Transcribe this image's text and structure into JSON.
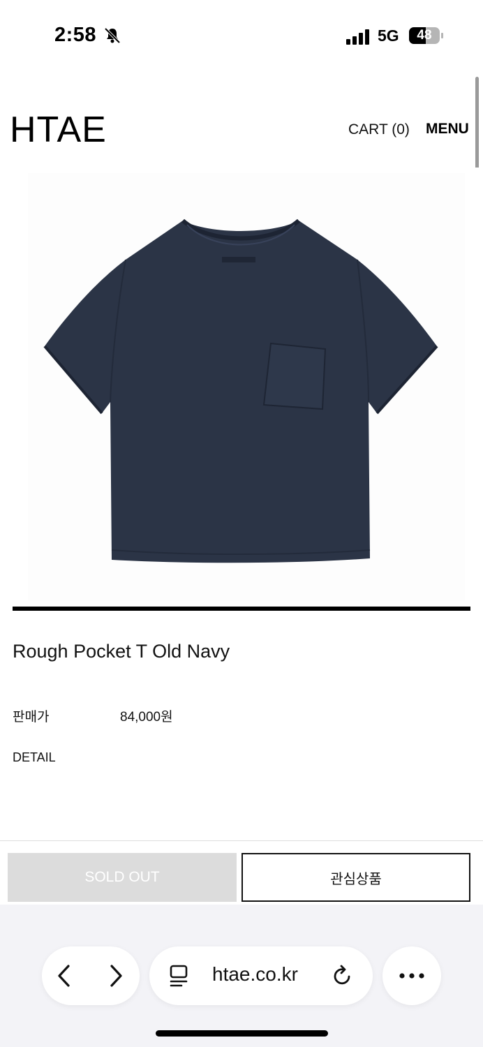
{
  "status_bar": {
    "time": "2:58",
    "network": "5G",
    "battery": "48",
    "icons": [
      "bell-slash-icon",
      "signal-icon",
      "battery-icon"
    ]
  },
  "header": {
    "logo": "HTAE",
    "cart": "CART (0)",
    "menu": "MENU"
  },
  "product": {
    "image_icon": "tshirt-image",
    "name": "Rough Pocket T Old Navy",
    "price_label": "판매가",
    "price_value": "84,000원",
    "detail_label": "DETAIL",
    "shirt_color": "#2b3446"
  },
  "actions": {
    "sold_out": "SOLD OUT",
    "wishlist": "관심상품"
  },
  "browser": {
    "url": "htae.co.kr",
    "icons": [
      "back-icon",
      "forward-icon",
      "tabs-icon",
      "reload-icon",
      "more-icon"
    ]
  }
}
